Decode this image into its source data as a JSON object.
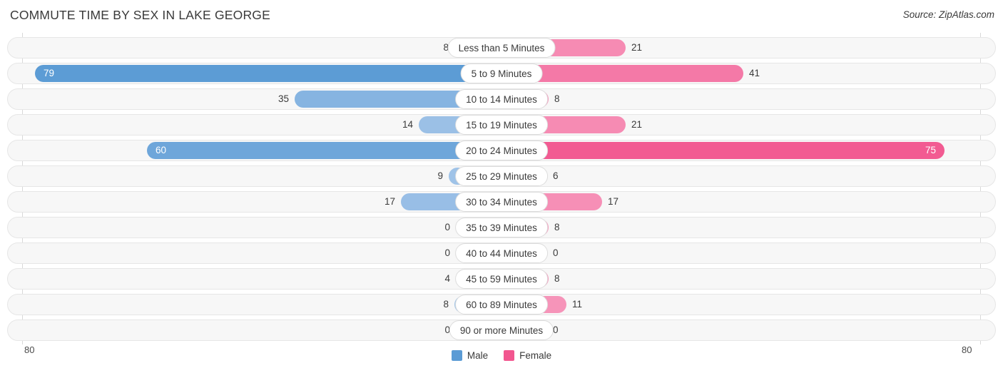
{
  "header": {
    "title": "COMMUTE TIME BY SEX IN LAKE GEORGE",
    "source": "Source: ZipAtlas.com"
  },
  "legend": {
    "items": [
      {
        "label": "Male",
        "color": "#5b9bd5"
      },
      {
        "label": "Female",
        "color": "#f2568f"
      }
    ]
  },
  "axis": {
    "left_tick": "80",
    "right_tick": "80"
  },
  "colors": {
    "male_strong": "#5b9bd5",
    "male_light": "#a8c8ea",
    "female_strong": "#f2568f",
    "female_light": "#f79ec0",
    "track_fill": "#f7f7f7",
    "track_border": "#e6e6e6",
    "gridline": "#d8d8d8",
    "text": "#3a3a3a"
  },
  "chart_data": {
    "type": "bar",
    "subtype": "diverging-bidirectional",
    "title": "COMMUTE TIME BY SEX IN LAKE GEORGE",
    "xlabel": "",
    "ylabel": "",
    "xlim": [
      80,
      80
    ],
    "axis_max": 80,
    "grid": true,
    "legend_position": "bottom-center",
    "categories": [
      "Less than 5 Minutes",
      "5 to 9 Minutes",
      "10 to 14 Minutes",
      "15 to 19 Minutes",
      "20 to 24 Minutes",
      "25 to 29 Minutes",
      "30 to 34 Minutes",
      "35 to 39 Minutes",
      "40 to 44 Minutes",
      "45 to 59 Minutes",
      "60 to 89 Minutes",
      "90 or more Minutes"
    ],
    "series": [
      {
        "name": "Male",
        "values": [
          8,
          79,
          35,
          14,
          60,
          9,
          17,
          0,
          0,
          4,
          8,
          0
        ]
      },
      {
        "name": "Female",
        "values": [
          21,
          41,
          8,
          21,
          75,
          6,
          17,
          8,
          0,
          8,
          11,
          0
        ]
      }
    ]
  },
  "rows": [
    {
      "label": "Less than 5 Minutes",
      "male": "8",
      "female": "21",
      "male_value": 8,
      "female_value": 21
    },
    {
      "label": "5 to 9 Minutes",
      "male": "79",
      "female": "41",
      "male_value": 79,
      "female_value": 41
    },
    {
      "label": "10 to 14 Minutes",
      "male": "35",
      "female": "8",
      "male_value": 35,
      "female_value": 8
    },
    {
      "label": "15 to 19 Minutes",
      "male": "14",
      "female": "21",
      "male_value": 14,
      "female_value": 21
    },
    {
      "label": "20 to 24 Minutes",
      "male": "60",
      "female": "75",
      "male_value": 60,
      "female_value": 75
    },
    {
      "label": "25 to 29 Minutes",
      "male": "9",
      "female": "6",
      "male_value": 9,
      "female_value": 6
    },
    {
      "label": "30 to 34 Minutes",
      "male": "17",
      "female": "17",
      "male_value": 17,
      "female_value": 17
    },
    {
      "label": "35 to 39 Minutes",
      "male": "0",
      "female": "8",
      "male_value": 0,
      "female_value": 8
    },
    {
      "label": "40 to 44 Minutes",
      "male": "0",
      "female": "0",
      "male_value": 0,
      "female_value": 0
    },
    {
      "label": "45 to 59 Minutes",
      "male": "4",
      "female": "8",
      "male_value": 4,
      "female_value": 8
    },
    {
      "label": "60 to 89 Minutes",
      "male": "8",
      "female": "11",
      "male_value": 8,
      "female_value": 11
    },
    {
      "label": "90 or more Minutes",
      "male": "0",
      "female": "0",
      "male_value": 0,
      "female_value": 0
    }
  ]
}
